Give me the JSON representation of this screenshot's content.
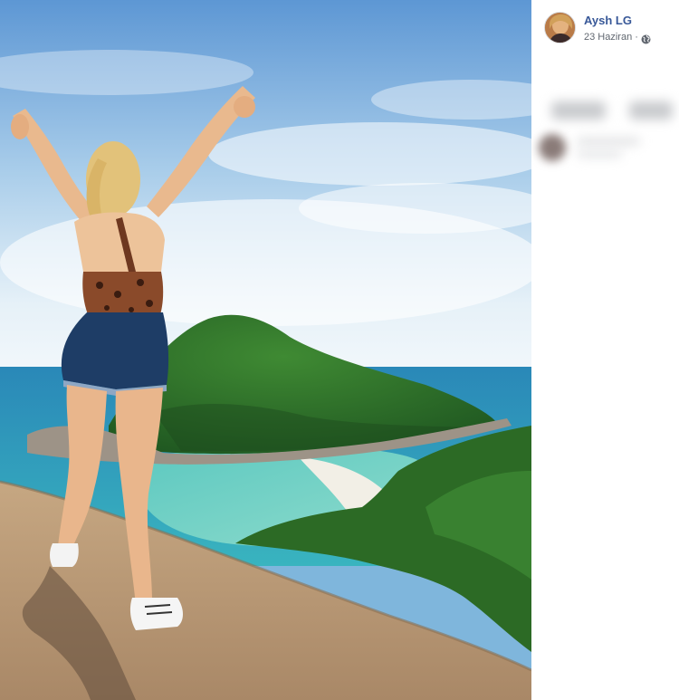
{
  "post": {
    "author_name": "Aysh LG",
    "date": "23 Haziran",
    "separator": "·",
    "privacy_icon": "globe-icon",
    "avatar_icon": "avatar"
  },
  "photo": {
    "scene": "photo"
  },
  "colors": {
    "author_link": "#385898",
    "meta_text": "#616770",
    "sky": "#7fb6dc",
    "sea": "#2fa0b8",
    "island": "#2f6e2a"
  }
}
